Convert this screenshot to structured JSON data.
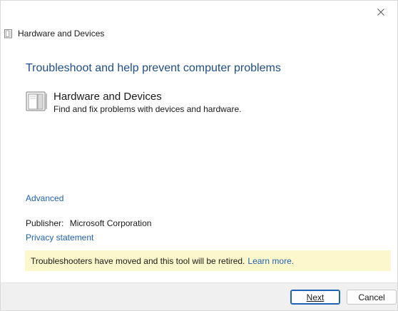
{
  "window": {
    "title": "Hardware and Devices",
    "close_icon": "close-icon"
  },
  "main": {
    "heading": "Troubleshoot and help prevent computer problems",
    "troubleshooter": {
      "icon": "hardware-devices-icon",
      "title": "Hardware and Devices",
      "description": "Find and fix problems with devices and hardware."
    },
    "advanced_link": "Advanced",
    "publisher_label": "Publisher:",
    "publisher_value": "Microsoft Corporation",
    "privacy_link": "Privacy statement",
    "notice": {
      "text": "Troubleshooters have moved and this tool will be retired.",
      "link": "Learn more."
    }
  },
  "footer": {
    "next_label": "Next",
    "cancel_label": "Cancel"
  },
  "colors": {
    "heading": "#1e4e8c",
    "link": "#1f61b4",
    "notice_bg": "#fdf8cb",
    "footer_bg": "#f0f0f0"
  }
}
